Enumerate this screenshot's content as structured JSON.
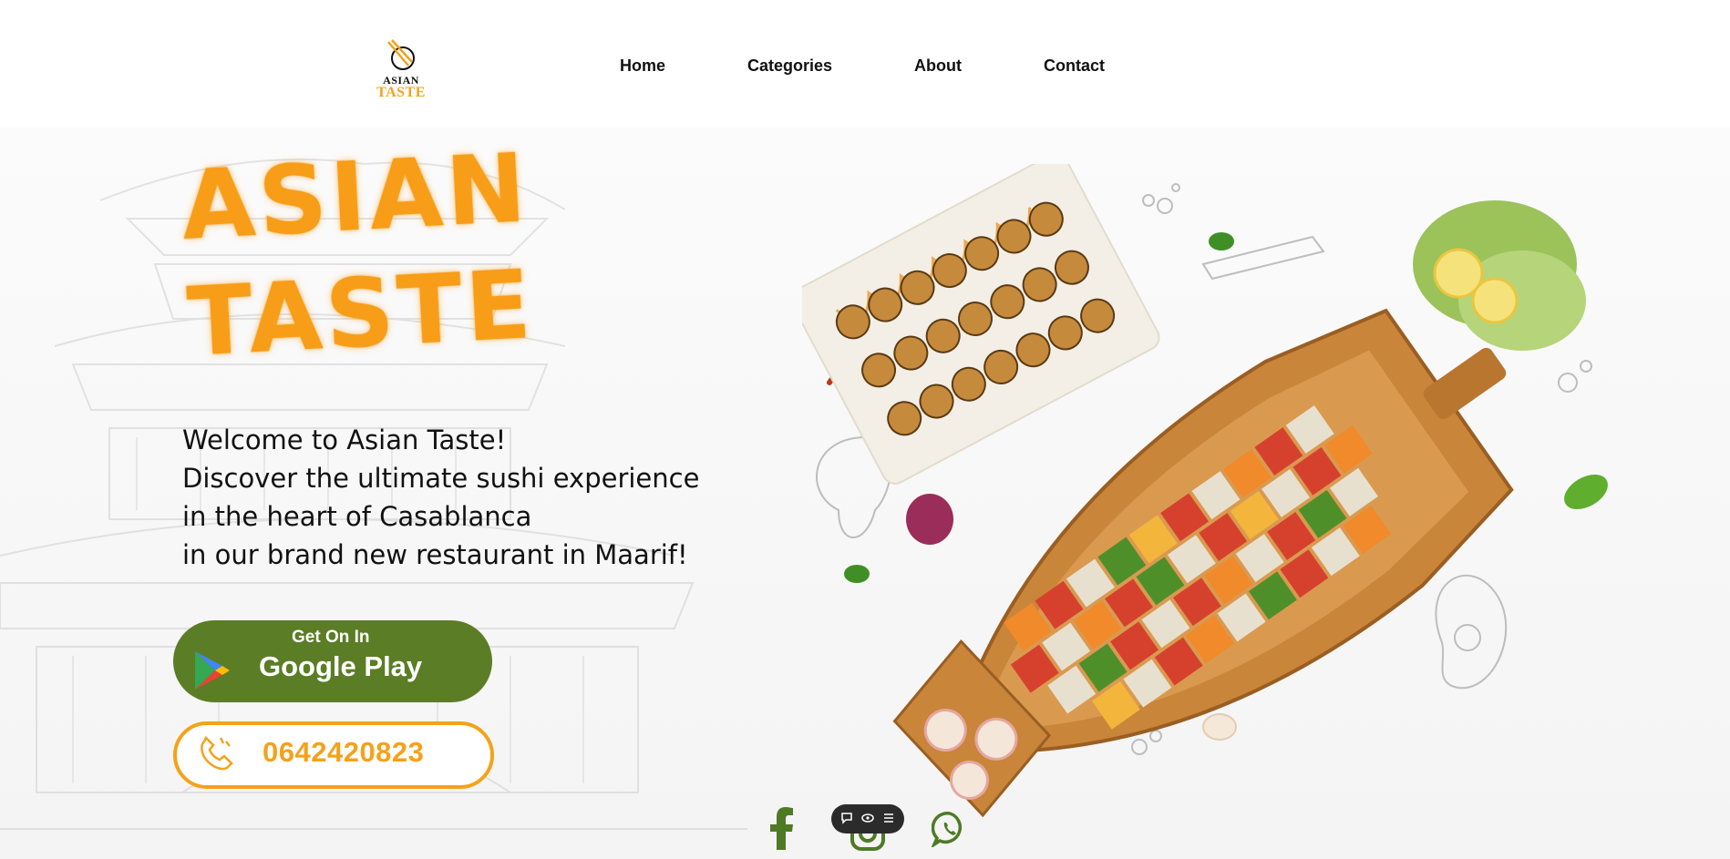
{
  "logo": {
    "line1": "ASIAN",
    "line2": "TASTE"
  },
  "nav": [
    {
      "label": "Home"
    },
    {
      "label": "Categories"
    },
    {
      "label": "About"
    },
    {
      "label": "Contact"
    }
  ],
  "hero": {
    "brand_line1": "ASIAN",
    "brand_line2": "TASTE",
    "welcome_lines": [
      "Welcome to Asian Taste!",
      "Discover the ultimate sushi experience",
      "in the heart of Casablanca",
      "in our brand new restaurant in Maarif!"
    ]
  },
  "google_play": {
    "top": "Get On In",
    "main": "Google Play"
  },
  "phone": {
    "number": "0642420823"
  },
  "socials": [
    "facebook-icon",
    "instagram-icon",
    "whatsapp-icon"
  ],
  "colors": {
    "brand_orange": "#f89d17",
    "green": "#5b7d25",
    "phone_orange": "#f4a21a"
  }
}
